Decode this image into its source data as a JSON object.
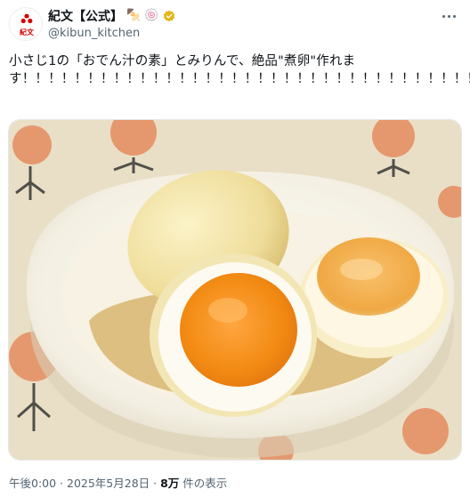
{
  "post": {
    "author": {
      "display_name": "紀文【公式】",
      "badge_emojis": "🍢 🍥",
      "handle": "@kibun_kitchen",
      "avatar_label": "紀文"
    },
    "text": "小さじ1の「おでん汁の素」とみりんで、絶品\"煮卵\"作れます！！！！！！！！！！！！！！！！！！！！！！！！！！！！！！！！！！！！",
    "media": {
      "description_icon": "photo-icon"
    },
    "meta": {
      "time": "午後0:00",
      "date": "2025年5月28日",
      "views_count": "8万",
      "views_label": "件の表示",
      "sep": " · "
    }
  },
  "colors": {
    "brand_red": "#d40000",
    "verified_gold": "#e2b719",
    "text_secondary": "#536471"
  }
}
